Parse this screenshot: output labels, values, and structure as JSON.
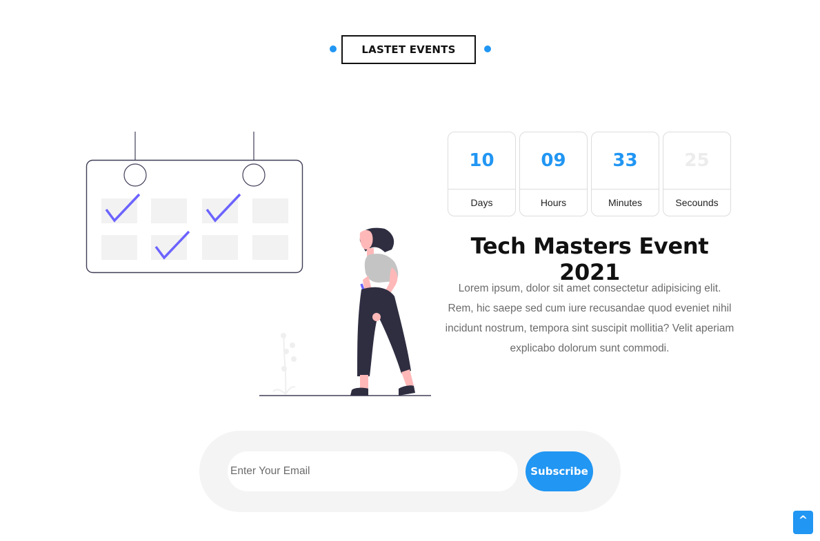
{
  "section": {
    "heading": "LASTET EVENTS"
  },
  "countdown": [
    {
      "value": "10",
      "label": "Days"
    },
    {
      "value": "09",
      "label": "Hours"
    },
    {
      "value": "33",
      "label": "Minutes"
    },
    {
      "value": "25",
      "label": "Secounds"
    }
  ],
  "event": {
    "title": "Tech Masters Event 2021",
    "description": "Lorem ipsum, dolor sit amet consectetur adipisicing elit. Rem, hic saepe sed cum iure recusandae quod eveniet nihil incidunt nostrum, tempora sint suscipit mollitia? Velit aperiam explicabo dolorum sunt commodi."
  },
  "subscribe": {
    "placeholder": "Enter Your Email",
    "button_label": "Subscribe"
  },
  "scroll_top": {
    "icon": "caret-up-icon",
    "glyph": "^"
  },
  "colors": {
    "accent": "#2196f3",
    "check": "#6c63ff",
    "text_muted": "#6b6b6b",
    "panel_bg": "#f4f4f4"
  }
}
